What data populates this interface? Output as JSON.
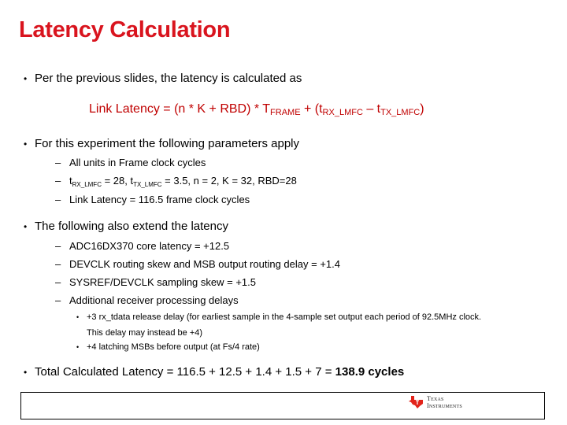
{
  "title": "Latency Calculation",
  "bullets": {
    "b1": "Per the previous slides, the latency is calculated as",
    "formula": {
      "prefix": "Link Latency = (n * K + RBD) * T",
      "t_frame_sub": "FRAME",
      "mid": " + (t",
      "rx_sub": "RX_LMFC",
      "minus": " – t",
      "tx_sub": "TX_LMFC",
      "suffix": ")"
    },
    "b2": "For this experiment the following parameters apply",
    "b2_items": {
      "i1": "All units in Frame clock cycles",
      "i2": {
        "t1": "t",
        "t1_sub": "RX_LMFC",
        "t1_val": " = 28, t",
        "t2_sub": "TX_LMFC",
        "rest": " = 3.5, n = 2, K = 32, RBD=28"
      },
      "i3": "Link Latency = 116.5 frame clock cycles"
    },
    "b3": "The following also extend the latency",
    "b3_items": {
      "i1": "ADC16DX370 core latency = +12.5",
      "i2": "DEVCLK routing skew and MSB output routing delay = +1.4",
      "i3": "SYSREF/DEVCLK sampling skew = +1.5",
      "i4": "Additional receiver processing delays",
      "sub1_line1": "+3 rx_tdata release delay (for earliest sample in the 4-sample set output each period of 92.5MHz clock.",
      "sub1_line2": "This delay may instead be +4)",
      "sub2": "+4 latching MSBs before output (at Fs/4 rate)"
    },
    "b4": "Total Calculated Latency = 116.5 + 12.5 + 1.4 + 1.5 + 7 = ",
    "b4_bold": "138.9 cycles"
  },
  "footer": {
    "logo_line1": "Texas",
    "logo_line2": "Instruments"
  },
  "colors": {
    "title": "#d9141e",
    "formula": "#c00000",
    "logo": "#e2231a"
  }
}
